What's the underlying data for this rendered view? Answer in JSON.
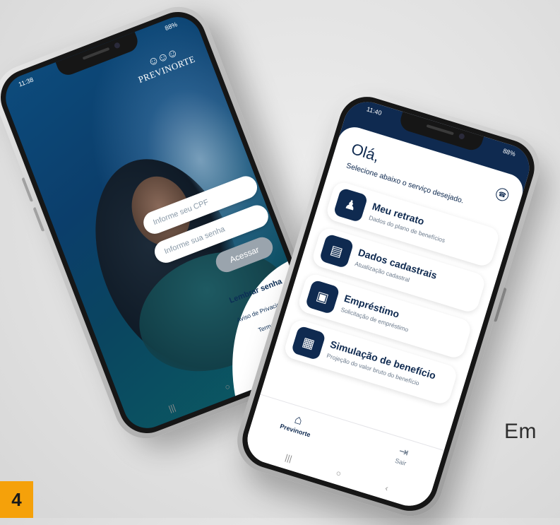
{
  "login_screen": {
    "status_time": "11:38",
    "status_right": "88%",
    "brand": "PREVINORTE",
    "brand_icon": "people-logo-icon",
    "cpf_placeholder": "Informe seu CPF",
    "password_placeholder": "Informe sua senha",
    "submit_label": "Acessar",
    "forgot_password": "Lembrar senha",
    "privacy_notice": "Aviso de Privacidade",
    "terms": "Termos de uso"
  },
  "menu_screen": {
    "status_time": "11:40",
    "status_right": "88%",
    "greeting": "Olá,",
    "subtitle": "Selecione abaixo o serviço desejado.",
    "services": [
      {
        "title": "Meu retrato",
        "subtitle": "Dados do plano de benefícios",
        "icon": "person-card-icon"
      },
      {
        "title": "Dados cadastrais",
        "subtitle": "Atualização cadastral",
        "icon": "id-card-icon"
      },
      {
        "title": "Empréstimo",
        "subtitle": "Solicitação de empréstimo",
        "icon": "money-icon"
      },
      {
        "title": "Simulação de benefício",
        "subtitle": "Projeção do valor bruto do benefício",
        "icon": "calculator-icon"
      }
    ],
    "tabs": {
      "home_label": "Previnorte",
      "exit_label": "Sair"
    }
  },
  "overlay_text": "Em",
  "page_number": "4",
  "colors": {
    "brand_navy": "#0f2a50",
    "login_blue": "#0b3a63",
    "badge_orange": "#f5a10a"
  }
}
